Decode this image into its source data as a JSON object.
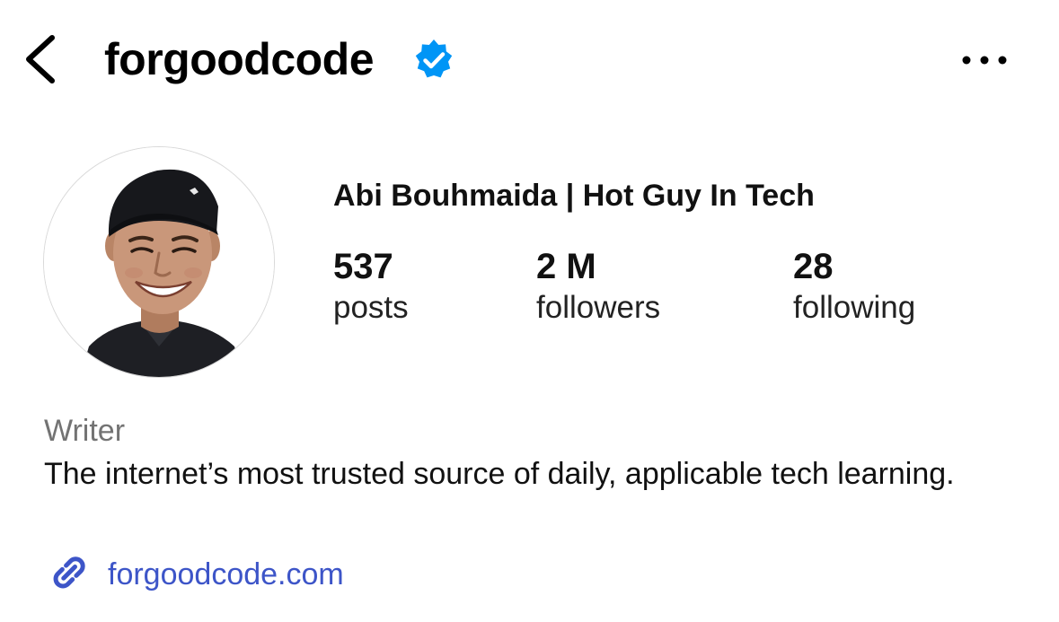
{
  "header": {
    "username": "forgoodcode",
    "verified": true,
    "icons": {
      "back": "chevron-left-icon",
      "verified": "verified-badge-icon",
      "more": "more-horizontal-icon"
    }
  },
  "profile": {
    "display_name": "Abi Bouhmaida | Hot Guy In Tech",
    "stats": [
      {
        "value": "537",
        "label": "posts"
      },
      {
        "value": "2 M",
        "label": "followers"
      },
      {
        "value": "28",
        "label": "following"
      }
    ],
    "category": "Writer",
    "bio": "The internet’s most trusted source of daily, applicable tech learning.",
    "link": {
      "text": "forgoodcode.com",
      "icon": "link-icon"
    }
  },
  "colors": {
    "verified_blue": "#0095f6",
    "link_blue": "#3d55c8",
    "category_gray": "#737373",
    "text": "#111111"
  }
}
